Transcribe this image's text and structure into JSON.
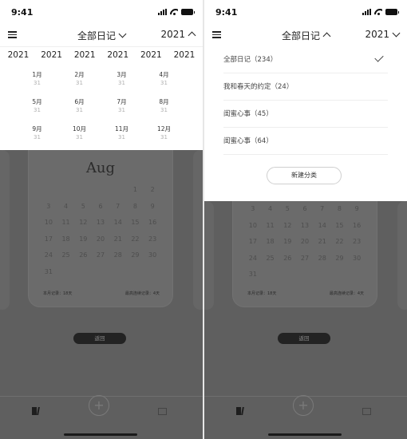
{
  "status": {
    "time": "9:41"
  },
  "left": {
    "header": {
      "title": "全部日记",
      "year": "2021"
    },
    "years": [
      "2021",
      "2021",
      "2021",
      "2021",
      "2021",
      "2021"
    ],
    "months": [
      {
        "label": "1月",
        "days": "31"
      },
      {
        "label": "2月",
        "days": "31"
      },
      {
        "label": "3月",
        "days": "31"
      },
      {
        "label": "4月",
        "days": "31"
      },
      {
        "label": "5月",
        "days": "31"
      },
      {
        "label": "6月",
        "days": "31"
      },
      {
        "label": "7月",
        "days": "31"
      },
      {
        "label": "8月",
        "days": "31"
      },
      {
        "label": "9月",
        "days": "31"
      },
      {
        "label": "10月",
        "days": "31"
      },
      {
        "label": "11月",
        "days": "31"
      },
      {
        "label": "12月",
        "days": "31"
      }
    ],
    "calendar": {
      "month": "Aug",
      "days": [
        "",
        "",
        "",
        "",
        "",
        "1",
        "2",
        "3",
        "4",
        "5",
        "6",
        "7",
        "8",
        "9",
        "10",
        "11",
        "12",
        "13",
        "14",
        "15",
        "16",
        "17",
        "18",
        "19",
        "20",
        "21",
        "22",
        "23",
        "24",
        "25",
        "26",
        "27",
        "28",
        "29",
        "30",
        "31"
      ],
      "footer_left": "本月记录：18天",
      "footer_right": "最高连续记录：4天"
    },
    "back_label": "返回"
  },
  "right": {
    "header": {
      "title": "全部日记",
      "year": "2021"
    },
    "categories": [
      {
        "label": "全部日记（234）",
        "selected": true
      },
      {
        "label": "我和春天的约定（24）",
        "selected": false
      },
      {
        "label": "闺蜜心事（45）",
        "selected": false
      },
      {
        "label": "闺蜜心事（64）",
        "selected": false
      }
    ],
    "new_category_label": "新建分类",
    "calendar": {
      "days": [
        "3",
        "4",
        "5",
        "6",
        "7",
        "8",
        "9",
        "10",
        "11",
        "12",
        "13",
        "14",
        "15",
        "16",
        "17",
        "18",
        "19",
        "20",
        "21",
        "22",
        "23",
        "24",
        "25",
        "26",
        "27",
        "28",
        "29",
        "30",
        "31"
      ],
      "footer_left": "本月记录：18天",
      "footer_right": "最高连续记录：4天"
    },
    "back_label": "返回"
  },
  "icons": [
    "menu-icon",
    "chevron-down-icon",
    "chevron-up-icon",
    "checkmark-icon",
    "book-icon",
    "plus-icon",
    "chart-icon",
    "signal-icon",
    "wifi-icon",
    "battery-icon"
  ]
}
